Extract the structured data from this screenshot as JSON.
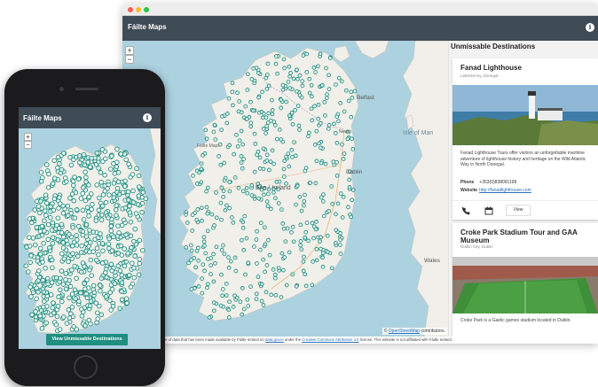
{
  "desktop": {
    "app_title": "Fáilte Maps",
    "info_label": "i",
    "map": {
      "zoom_in": "+",
      "zoom_out": "−",
      "place_labels": [
        {
          "id": "belfast",
          "text": "Belfast"
        },
        {
          "id": "newry",
          "text": "Newry"
        },
        {
          "id": "isle-of-man",
          "text": "Isle of Man"
        },
        {
          "id": "dublin",
          "text": "Dublin"
        },
        {
          "id": "eire",
          "text": "Éire / Ireland"
        },
        {
          "id": "failte-maps",
          "text": "Fáilte Maps"
        },
        {
          "id": "wales",
          "text": "Wales"
        }
      ],
      "attribution_prefix": "©",
      "attribution_link": "OpenStreetMap",
      "attribution_suffix": "contributors."
    },
    "footer": {
      "text1": "e of data that has been made available by Fáilte Ireland on",
      "link1": "data.gov.ie",
      "text2": "under the",
      "link2": "Creative Commons Attribution 4.0",
      "text3": "license. This website is not affiliated with Fáilte Ireland."
    },
    "sidebar": {
      "title": "Unmissable Destinations",
      "cards": [
        {
          "title": "Fanad Lighthouse",
          "subtitle": "Letterkenny, Donegal",
          "description": "Fanad Lighthouse Tours offer visitors an unforgettable maritime adventure of lighthouse history and heritage on the Wild Atlantic Way in North Donegal.",
          "phone_label": "Phone",
          "phone": "+353(0)838091199",
          "website_label": "Website",
          "website": "http://fanadlighthouse.com",
          "view_label": "View"
        },
        {
          "title": "Croke Park Stadium Tour and GAA Museum",
          "subtitle": "Dublin City, Dublin",
          "description": "Croke Park is a Gaelic games stadium located in Dublin."
        }
      ]
    }
  },
  "mobile": {
    "app_title": "Fáilte Maps",
    "info_label": "i",
    "zoom_in": "+",
    "zoom_out": "−",
    "view_button": "View Unmissable Destinations"
  },
  "colors": {
    "header": "#3f4b55",
    "sea": "#acd2df",
    "land": "#f1efe9",
    "marker": "#1f8f80",
    "button": "#1f8f80"
  }
}
